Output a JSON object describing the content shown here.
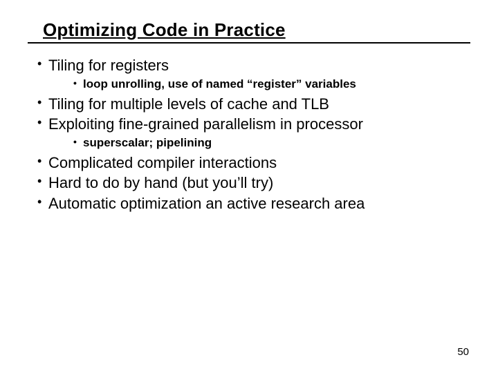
{
  "title": "Optimizing Code in Practice",
  "bullets": {
    "b1": "Tiling for registers",
    "b1_sub1": "loop unrolling, use of named “register” variables",
    "b2": "Tiling for multiple levels of cache and TLB",
    "b3": "Exploiting fine-grained parallelism in processor",
    "b3_sub1": "superscalar; pipelining",
    "b4": "Complicated compiler interactions",
    "b5": "Hard to do by hand (but you’ll try)",
    "b6": "Automatic optimization an active research area"
  },
  "page_number": "50"
}
